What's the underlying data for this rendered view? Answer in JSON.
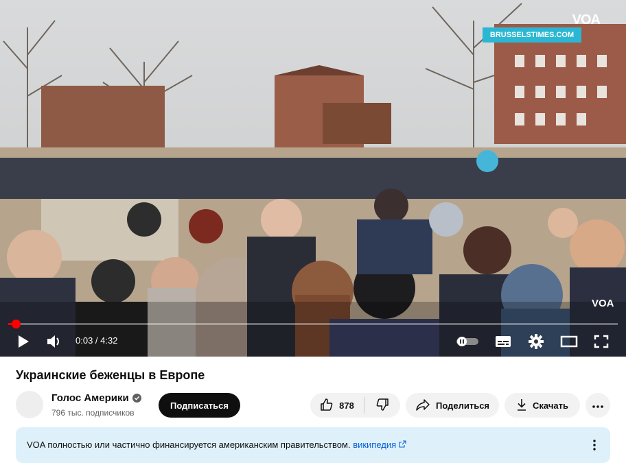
{
  "player": {
    "watermark": "VOA",
    "source_badge": "BRUSSELSTIMES.COM",
    "watermark_small": "VOA",
    "progress_fraction": 0.012,
    "current_time": "0:03",
    "duration": "4:32",
    "time_text": "0:03 / 4:32",
    "accent_color": "#ff0000"
  },
  "video": {
    "title": "Украинские беженцы в Европе"
  },
  "channel": {
    "name": "Голос Америки",
    "subscribers": "796 тыс. подписчиков",
    "verified_icon": "verified-check-icon"
  },
  "actions": {
    "subscribe_label": "Подписаться",
    "like_count": "878",
    "share_label": "Поделиться",
    "download_label": "Скачать"
  },
  "notice": {
    "text": "VOA полностью или частично финансируется американским правительством.",
    "link_text": "википедия",
    "background_color": "#def1fb"
  },
  "icons": {
    "play": "play-icon",
    "volume": "volume-icon",
    "autoplay": "autoplay-toggle-icon",
    "subtitles": "subtitles-icon",
    "settings": "gear-icon",
    "theater": "theater-mode-icon",
    "fullscreen": "fullscreen-icon",
    "like": "thumbs-up-icon",
    "dislike": "thumbs-down-icon",
    "share": "share-arrow-icon",
    "download": "download-icon",
    "more": "more-vertical-icon",
    "external": "external-link-icon"
  }
}
